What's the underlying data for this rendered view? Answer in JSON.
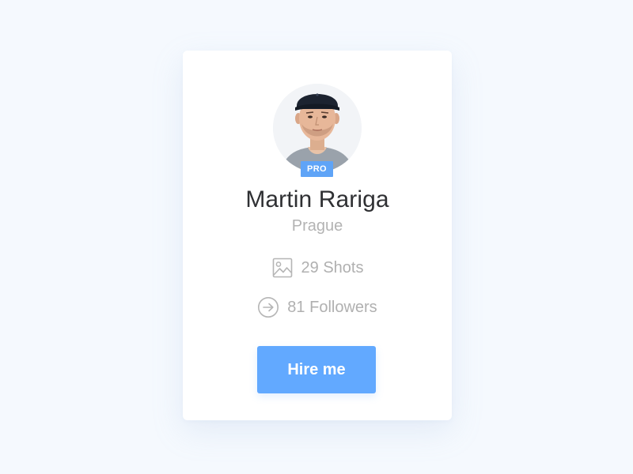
{
  "profile": {
    "name": "Martin Rariga",
    "location": "Prague",
    "badge": "PRO",
    "avatar_icon": "portrait-photo"
  },
  "stats": {
    "shots_label": "29 Shots",
    "shots_icon": "image-icon",
    "followers_label": "81 Followers",
    "followers_icon": "arrow-circle-icon"
  },
  "actions": {
    "hire_label": "Hire me"
  },
  "colors": {
    "page_background": "#f5f9fe",
    "card_background": "#ffffff",
    "accent": "#62a9ff",
    "badge": "#5fa4f7",
    "name_text": "#2f3033",
    "muted_text": "#b0b0b0"
  }
}
